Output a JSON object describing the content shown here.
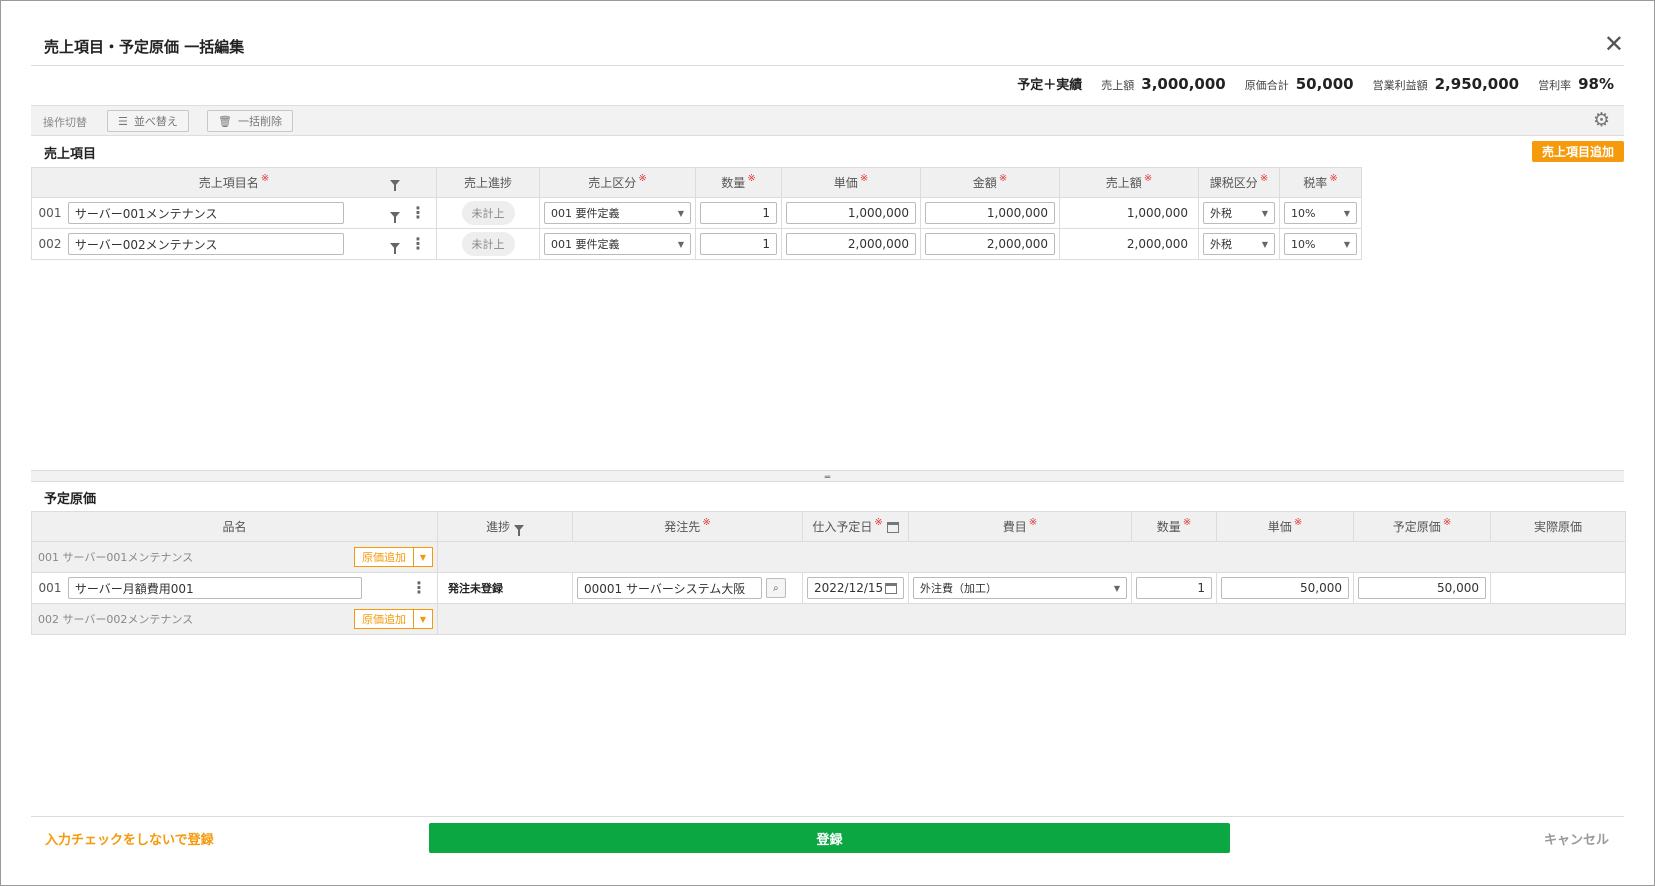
{
  "header": {
    "title": "売上項目・予定原価 一括編集"
  },
  "summary": {
    "mode": "予定＋実績",
    "sales_label": "売上額",
    "sales_value": "3,000,000",
    "cost_label": "原価合計",
    "cost_value": "50,000",
    "profit_label": "営業利益額",
    "profit_value": "2,950,000",
    "rate_label": "営利率",
    "rate_value": "98%"
  },
  "toolbar": {
    "mode_label": "操作切替",
    "sort_label": "並べ替え",
    "bulk_delete_label": "一括削除"
  },
  "sales": {
    "title": "売上項目",
    "add_label": "売上項目追加",
    "columns": [
      "売上項目名",
      "売上進捗",
      "売上区分",
      "数量",
      "単価",
      "金額",
      "売上額",
      "課税区分",
      "税率"
    ],
    "rows": [
      {
        "no": "001",
        "name": "サーバー001メンテナンス",
        "progress": "未計上",
        "category": "001 要件定義",
        "qty": "1",
        "unit_price": "1,000,000",
        "amount": "1,000,000",
        "sales": "1,000,000",
        "tax_type": "外税",
        "tax_rate": "10%"
      },
      {
        "no": "002",
        "name": "サーバー002メンテナンス",
        "progress": "未計上",
        "category": "001 要件定義",
        "qty": "1",
        "unit_price": "2,000,000",
        "amount": "2,000,000",
        "sales": "2,000,000",
        "tax_type": "外税",
        "tax_rate": "10%"
      }
    ]
  },
  "cost": {
    "title": "予定原価",
    "columns": [
      "品名",
      "進捗",
      "発注先",
      "仕入予定日",
      "費目",
      "数量",
      "単価",
      "予定原価",
      "実際原価"
    ],
    "add_cost_label": "原価追加",
    "groups": [
      {
        "label": "001 サーバー001メンテナンス"
      },
      {
        "label": "002 サーバー002メンテナンス"
      }
    ],
    "rows": [
      {
        "no": "001",
        "name": "サーバー月額費用001",
        "progress": "発注未登録",
        "vendor": "00001 サーバーシステム大阪",
        "date": "2022/12/15",
        "expense": "外注費（加工）",
        "qty": "1",
        "unit_price": "50,000",
        "planned": "50,000",
        "actual": ""
      }
    ]
  },
  "footer": {
    "nocheck_label": "入力チェックをしないで登録",
    "submit_label": "登録",
    "cancel_label": "キャンセル"
  }
}
